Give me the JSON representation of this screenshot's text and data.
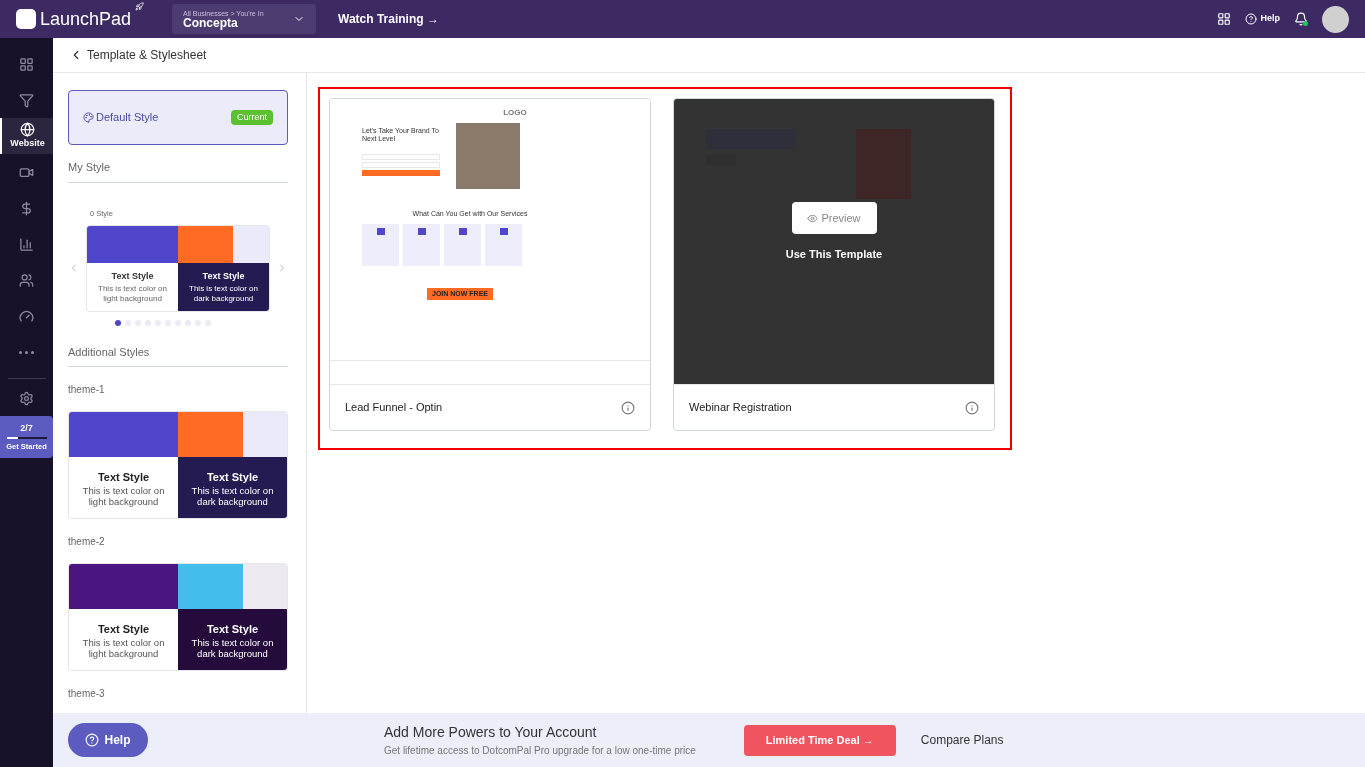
{
  "topbar": {
    "brand": "LaunchPad",
    "business": {
      "caption": "All Businesses > You're In",
      "name": "Concepta"
    },
    "training_link": "Watch Training →",
    "help": "Help",
    "notification_dot": true
  },
  "nav": [
    {
      "selected": false,
      "kind": "dashboard"
    },
    {
      "selected": false,
      "kind": "funnel"
    },
    {
      "label": "Website",
      "selected": true,
      "kind": "globe"
    },
    {
      "selected": false,
      "kind": "video"
    },
    {
      "selected": false,
      "kind": "dollar"
    },
    {
      "selected": false,
      "kind": "chart"
    },
    {
      "selected": false,
      "kind": "people"
    },
    {
      "selected": false,
      "kind": "gauge"
    },
    {
      "selected": false,
      "kind": "more"
    }
  ],
  "progress": {
    "count": "2/7",
    "label": "Get Started",
    "level": 0.29
  },
  "page_title": "Template & Stylesheet",
  "default_style": {
    "label": "Default Style",
    "badge": "Current"
  },
  "my_style": {
    "heading": "My Style",
    "count": "0 Style",
    "card": {
      "kind": "indigo",
      "light_title": "Text Style",
      "light_text": "This is text color on light background",
      "dark_title": "Text Style",
      "dark_text": "This is text color on dark background"
    },
    "dots": [
      {
        "selected": true
      },
      {
        "selected": false
      },
      {
        "selected": false
      },
      {
        "selected": false
      },
      {
        "selected": false
      },
      {
        "selected": false
      },
      {
        "selected": false
      },
      {
        "selected": false
      },
      {
        "selected": false
      },
      {
        "selected": false
      }
    ]
  },
  "additional_heading": "Additional Styles",
  "themes": [
    {
      "name": "theme-1",
      "kind": "indigo",
      "light_title": "Text Style",
      "light_text": "This is text color on light background",
      "dark_title": "Text Style",
      "dark_text": "This is text color on dark background"
    },
    {
      "name": "theme-2",
      "kind": "purple",
      "light_title": "Text Style",
      "light_text": "This is text color on light background",
      "dark_title": "Text Style",
      "dark_text": "This is text color on dark background"
    },
    {
      "name": "theme-3"
    }
  ],
  "templates": [
    {
      "name": "Lead Funnel - Optin",
      "hovered": false,
      "preview": {
        "kind": "optin",
        "logo": "LOGO",
        "headline": "Let's Take Your Brand To Next Level",
        "section": "What Can You Get with Our Services",
        "cta": "JOIN NOW FREE"
      }
    },
    {
      "name": "Webinar Registration",
      "hovered": true,
      "preview": {
        "kind": "webinar"
      },
      "preview_button": "Preview",
      "use_label": "Use This Template"
    }
  ],
  "footer": {
    "help": "Help",
    "title": "Add More Powers to Your Account",
    "subtitle": "Get lifetime access to DotcomPal Pro upgrade for a low one-time price",
    "deal": "Limited Time Deal →",
    "compare": "Compare Plans"
  }
}
